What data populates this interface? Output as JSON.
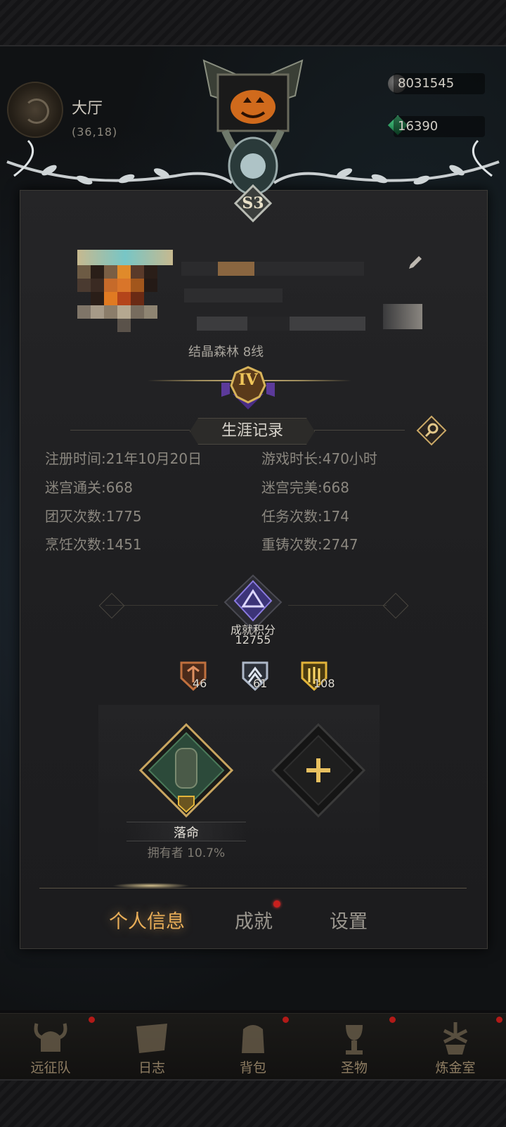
{
  "hud": {
    "location": "大厅",
    "coords": "(36,18)",
    "currency": [
      {
        "icon": "silver-coin-icon",
        "amount": "8031545"
      },
      {
        "icon": "green-gem-icon",
        "amount": "16390"
      }
    ]
  },
  "profile": {
    "season_badge": "S3",
    "server_line": "结晶森林 8线",
    "rank_numeral": "IV"
  },
  "career": {
    "title": "生涯记录",
    "stats": [
      {
        "label": "注册时间:",
        "value": "21年10月20日"
      },
      {
        "label": "游戏时长:",
        "value": "470小时"
      },
      {
        "label": "迷宫通关:",
        "value": "668"
      },
      {
        "label": "迷宫完美:",
        "value": "668"
      },
      {
        "label": "团灭次数:",
        "value": "1775"
      },
      {
        "label": "任务次数:",
        "value": "174"
      },
      {
        "label": "烹饪次数:",
        "value": "1451"
      },
      {
        "label": "重铸次数:",
        "value": "2747"
      }
    ]
  },
  "achievement": {
    "label": "成就积分",
    "score": "12755",
    "medals": [
      {
        "tier": "bronze",
        "count": "46",
        "color": "#c0703e"
      },
      {
        "tier": "silver",
        "count": "61",
        "color": "#aeb8c8"
      },
      {
        "tier": "gold",
        "count": "108",
        "color": "#e2b43a"
      }
    ]
  },
  "title_card": {
    "name": "落命",
    "owners": "拥有者 10.7%"
  },
  "tabs": [
    {
      "label": "个人信息",
      "active": true
    },
    {
      "label": "成就",
      "active": false,
      "badge": true
    },
    {
      "label": "设置",
      "active": false
    }
  ],
  "bottom_nav": [
    {
      "label": "远征队",
      "icon": "horned-helmet-icon"
    },
    {
      "label": "日志",
      "icon": "scroll-icon"
    },
    {
      "label": "背包",
      "icon": "backpack-icon"
    },
    {
      "label": "圣物",
      "icon": "chalice-icon"
    },
    {
      "label": "炼金室",
      "icon": "alchemy-icon"
    }
  ],
  "colors": {
    "accent_tab": "#e9ae58",
    "rank_gold": "#f0c65a",
    "badge_red": "#c8201e"
  }
}
